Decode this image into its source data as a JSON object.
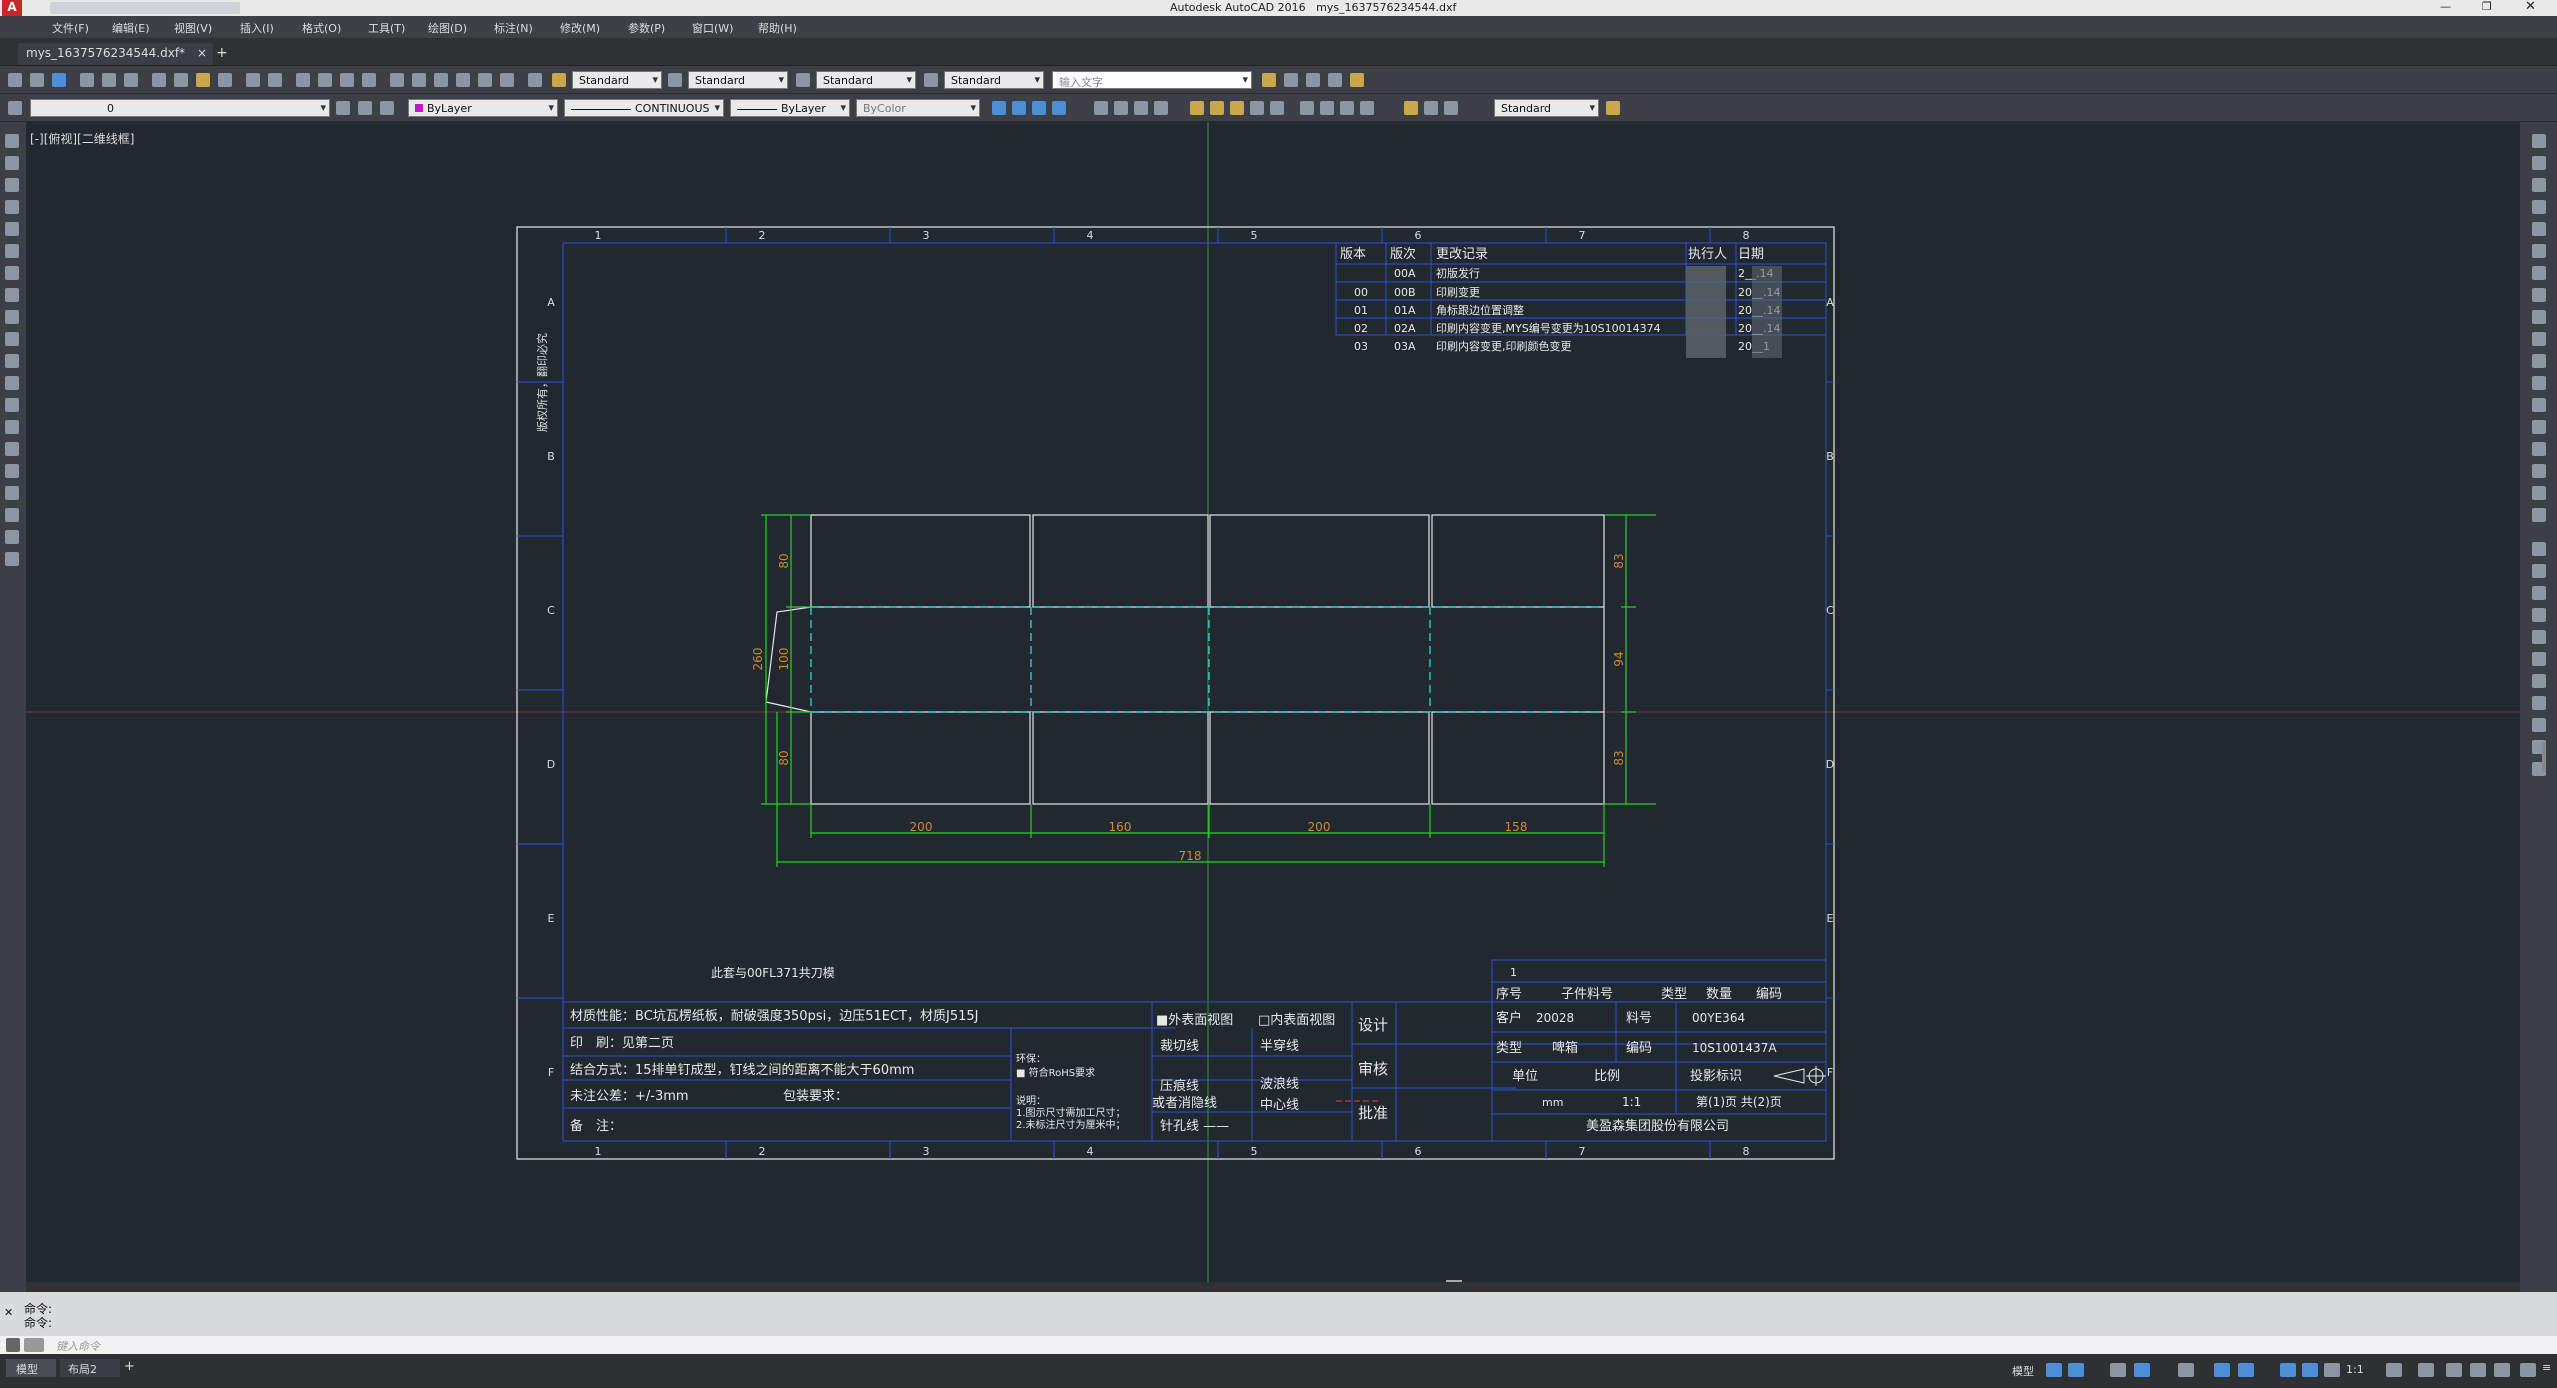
{
  "app": {
    "title": "Autodesk AutoCAD 2016",
    "file": "mys_1637576234544.dxf"
  },
  "menu": [
    "文件(F)",
    "编辑(E)",
    "视图(V)",
    "插入(I)",
    "格式(O)",
    "工具(T)",
    "绘图(D)",
    "标注(N)",
    "修改(M)",
    "参数(P)",
    "窗口(W)",
    "帮助(H)"
  ],
  "tab": {
    "label": "mys_1637576234544.dxf*",
    "close": "×",
    "add": "+"
  },
  "toolbar1": {
    "text_style": "Standard",
    "dim_style": "Standard",
    "table_style": "Standard",
    "mleader_style": "Standard",
    "search_placeholder": "输入文字"
  },
  "toolbar2": {
    "layer": "0",
    "color": "ByLayer",
    "linetype": "CONTINUOUS",
    "lineweight": "ByLayer",
    "plotstyle": "ByColor",
    "visual": "Standard"
  },
  "viewport_label": "[-][俯视][二维线框]",
  "drawing": {
    "col_labels": [
      "1",
      "2",
      "3",
      "4",
      "5",
      "6",
      "7",
      "8"
    ],
    "row_labels": [
      "A",
      "B",
      "C",
      "D",
      "E",
      "F"
    ],
    "side_note": "版权所有，翻印必究",
    "revision_header": [
      "版本",
      "版次",
      "更改记录",
      "执行人",
      "日期"
    ],
    "revisions": [
      {
        "ver": "",
        "rev": "00A",
        "note": "初版发行",
        "date": "2__.14"
      },
      {
        "ver": "00",
        "rev": "00B",
        "note": "印刷变更",
        "date": "20__.14"
      },
      {
        "ver": "01",
        "rev": "01A",
        "note": "角标跟边位置调整",
        "date": "20__.14"
      },
      {
        "ver": "02",
        "rev": "02A",
        "note": "印刷内容变更,MYS编号变更为10S10014374",
        "date": "20__.14"
      },
      {
        "ver": "03",
        "rev": "03A",
        "note": "印刷内容变更,印刷颜色变更",
        "date": "20__1"
      }
    ],
    "dims": {
      "w1": "200",
      "w2": "160",
      "w3": "200",
      "w4": "158",
      "total": "718",
      "h_top": "80",
      "h_mid": "100",
      "h_bot": "80",
      "h_total": "260",
      "r_top": "83",
      "r_mid": "94",
      "r_bot": "83"
    },
    "die_note": "此套与00FL371共刀模",
    "info": {
      "material": "材质性能：BC坑瓦楞纸板，耐破强度350psi，边压51ECT，材质J515J",
      "print": "印　刷：见第二页",
      "join": "结合方式：15排单钉成型，钉线之间的距离不能大于60mm",
      "tolerance": "未注公差：+/-3mm",
      "package": "包装要求：",
      "remark": "备　注：",
      "env_title": "环保：",
      "env_item": "■ 符合RoHS要求",
      "desc_title": "说明：",
      "desc1": "1.图示尺寸需加工尺寸；",
      "desc2": "2.未标注尺寸为厘米中；"
    },
    "views": {
      "outer": "■外表面视图",
      "inner": "□内表面视图"
    },
    "lines": {
      "cut": "裁切线",
      "half": "半穿线",
      "crease": "压痕线",
      "or_eliminate": "或者消隐线",
      "wave": "波浪线",
      "center": "中心线",
      "pin": "针孔线 ——"
    },
    "sign": {
      "design": "设计",
      "review": "审核",
      "approve": "批准"
    },
    "title_block": {
      "idx": "1",
      "h": [
        "序号",
        "子件料号",
        "类型",
        "数量",
        "编码"
      ],
      "customer_label": "客户",
      "customer": "20028",
      "part_label": "料号",
      "part": "00YE364",
      "type_label": "类型",
      "type": "啤箱",
      "code_label": "编码",
      "code": "10S1001437A",
      "unit_label": "单位",
      "scale_label": "比例",
      "proj_label": "投影标识",
      "unit": "mm",
      "scale": "1:1",
      "pages": "第(1)页 共(2)页",
      "company": "美盈森集团股份有限公司"
    }
  },
  "command": {
    "line1": "命令:",
    "line2": "命令:",
    "input_placeholder": "键入命令"
  },
  "status": {
    "model_tab": "模型",
    "layout_tab": "布局2",
    "model_btn": "模型",
    "scale": "1:1"
  }
}
